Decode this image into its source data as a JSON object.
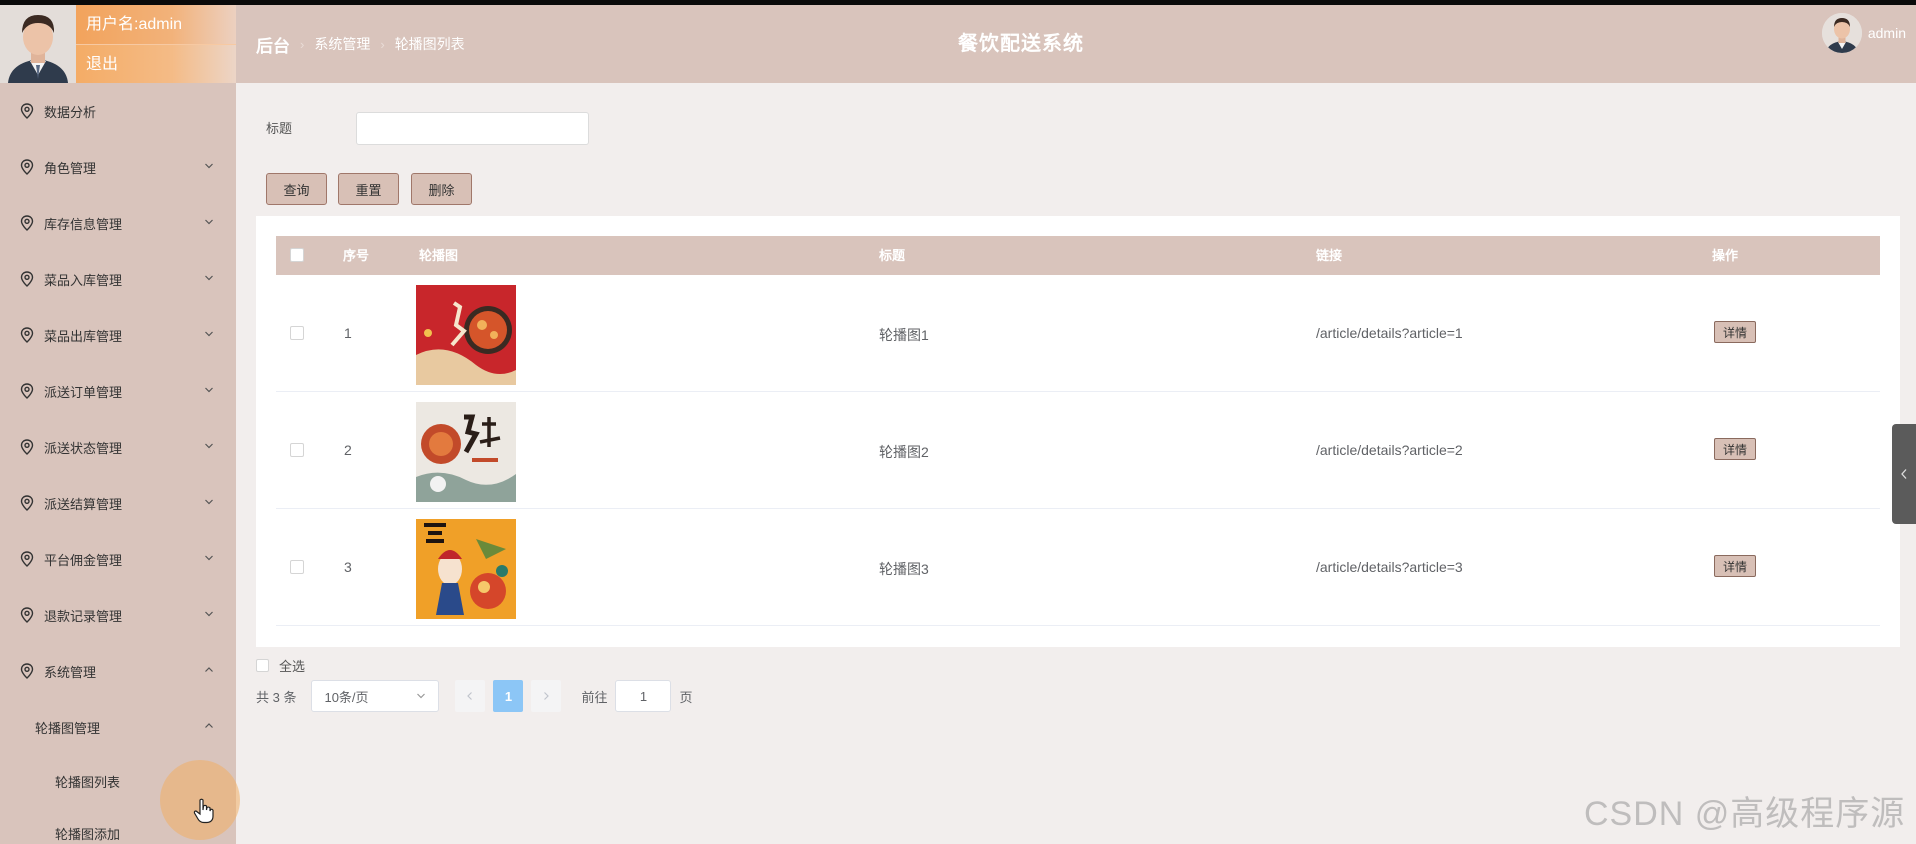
{
  "header": {
    "breadcrumb": [
      "后台",
      "系统管理",
      "轮播图列表"
    ],
    "system_title": "餐饮配送系统",
    "user": "admin"
  },
  "sidebar": {
    "username": "用户名:admin",
    "logout": "退出",
    "items": [
      {
        "label": "数据分析"
      },
      {
        "label": "角色管理"
      },
      {
        "label": "库存信息管理"
      },
      {
        "label": "菜品入库管理"
      },
      {
        "label": "菜品出库管理"
      },
      {
        "label": "派送订单管理"
      },
      {
        "label": "派送状态管理"
      },
      {
        "label": "派送结算管理"
      },
      {
        "label": "平台佣金管理"
      },
      {
        "label": "退款记录管理"
      },
      {
        "label": "系统管理"
      }
    ],
    "submenu": {
      "title": "轮播图管理",
      "items": [
        "轮播图列表",
        "轮播图添加"
      ]
    }
  },
  "search": {
    "label": "标题",
    "value": "",
    "placeholder": ""
  },
  "toolbar": {
    "query": "查询",
    "reset": "重置",
    "delete": "删除"
  },
  "table": {
    "columns": [
      "序号",
      "轮播图",
      "标题",
      "链接",
      "操作"
    ],
    "rows": [
      {
        "index": "1",
        "title": "轮播图1",
        "link": "/article/details?article=1",
        "action": "详情"
      },
      {
        "index": "2",
        "title": "轮播图2",
        "link": "/article/details?article=2",
        "action": "详情"
      },
      {
        "index": "3",
        "title": "轮播图3",
        "link": "/article/details?article=3",
        "action": "详情"
      }
    ]
  },
  "pagination": {
    "select_all": "全选",
    "total": "共 3 条",
    "page_size": "10条/页",
    "current_page": "1",
    "goto_label": "前往",
    "goto_value": "1",
    "page_suffix": "页"
  },
  "watermark": "CSDN @高级程序源"
}
